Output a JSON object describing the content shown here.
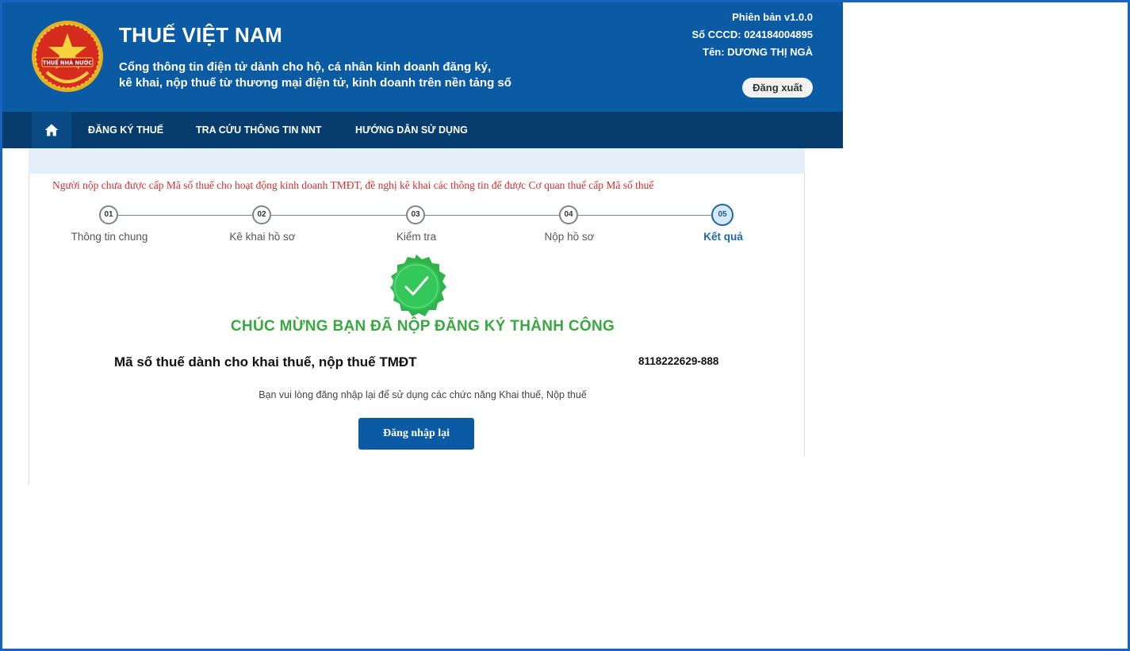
{
  "header": {
    "title": "THUẾ VIỆT NAM",
    "subtitle_line1": "Cổng thông tin điện tử dành cho hộ, cá nhân kinh doanh đăng ký,",
    "subtitle_line2": "kê khai, nộp thuế từ thương mại điện tử, kinh doanh trên nền tảng số",
    "emblem_text": "THUẾ NHÀ NƯỚC",
    "version": "Phiên bản v1.0.0",
    "cccd": "Số CCCD: 024184004895",
    "name": "Tên: DƯƠNG THỊ NGÀ",
    "logout_label": "Đăng xuất"
  },
  "nav": {
    "home_icon": "home-icon",
    "items": [
      "ĐĂNG KÝ THUẾ",
      "TRA CỨU THÔNG TIN NNT",
      "HƯỚNG DẪN SỬ DỤNG"
    ]
  },
  "warning": "Người nộp chưa được cấp Mã số thuế cho hoạt động kinh doanh TMĐT, đề nghị kê khai các thông tin để được Cơ quan thuế cấp Mã số thuế",
  "steps": [
    {
      "number": "01",
      "label": "Thông tin chung"
    },
    {
      "number": "02",
      "label": "Kê khai hồ sơ"
    },
    {
      "number": "03",
      "label": "Kiểm tra"
    },
    {
      "number": "04",
      "label": "Nộp hồ sơ"
    },
    {
      "number": "05",
      "label": "Kết quả"
    }
  ],
  "result": {
    "icon": "success-check-icon",
    "title": "CHÚC MỪNG BẠN ĐÃ NỘP ĐĂNG KÝ THÀNH CÔNG",
    "tax_code_label": "Mã số thuế dành cho khai thuế, nộp thuế TMĐT",
    "tax_code_value": "8118222629-888",
    "note": "Bạn vui lòng đăng nhập lại để sử dụng các chức năng Khai thuế, Nộp thuế",
    "relogin_label": "Đăng nhập lại"
  },
  "colors": {
    "header_bg": "#0a5aa4",
    "nav_bg": "#073d6e",
    "success_green": "#3aa841",
    "warning_red": "#d32f2f",
    "active_step": "#1a68ad"
  }
}
